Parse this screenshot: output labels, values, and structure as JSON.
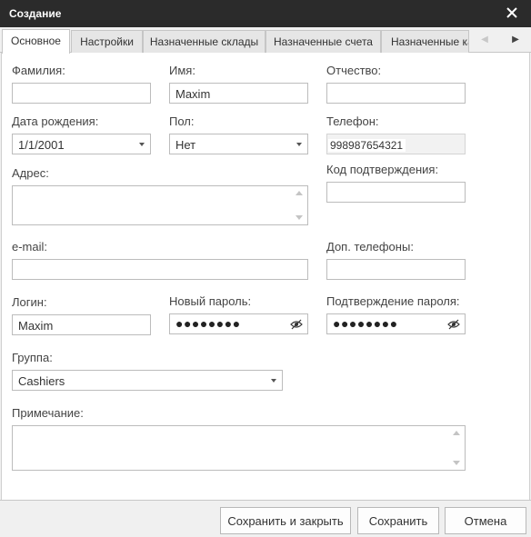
{
  "window": {
    "title": "Создание"
  },
  "tabs": {
    "items": [
      {
        "label": "Основное",
        "active": true
      },
      {
        "label": "Настройки"
      },
      {
        "label": "Назначенные склады"
      },
      {
        "label": "Назначенные счета"
      },
      {
        "label": "Назначенные ка"
      }
    ],
    "nav_prev": "◀",
    "nav_next": "▶"
  },
  "form": {
    "last_name": {
      "label": "Фамилия:",
      "value": ""
    },
    "first_name": {
      "label": "Имя:",
      "value": "Maxim"
    },
    "middle_name": {
      "label": "Отчество:",
      "value": ""
    },
    "birth_date": {
      "label": "Дата рождения:",
      "value": "1/1/2001"
    },
    "gender": {
      "label": "Пол:",
      "value": "Нет"
    },
    "phone": {
      "label": "Телефон:",
      "value": "998987654321"
    },
    "address": {
      "label": "Адрес:",
      "value": ""
    },
    "confirmation_code": {
      "label": "Код подтверждения:",
      "value": ""
    },
    "email": {
      "label": "e-mail:",
      "value": ""
    },
    "extra_phones": {
      "label": "Доп. телефоны:",
      "value": ""
    },
    "login": {
      "label": "Логин:",
      "value": "Maxim"
    },
    "new_password": {
      "label": "Новый пароль:",
      "value": "●●●●●●●●"
    },
    "confirm_password": {
      "label": "Подтверждение пароля:",
      "value": "●●●●●●●●"
    },
    "group": {
      "label": "Группа:",
      "value": "Cashiers"
    },
    "note": {
      "label": "Примечание:",
      "value": ""
    }
  },
  "footer": {
    "save_close": "Сохранить и закрыть",
    "save": "Сохранить",
    "cancel": "Отмена"
  },
  "colors": {
    "titlebar": "#2b2b2b",
    "background": "#f0f0f0",
    "panel": "#ffffff",
    "border": "#bcbcbc"
  },
  "icons": {
    "close": "close-icon",
    "eye": "eye-icon",
    "dropdown": "chevron-down-icon"
  }
}
